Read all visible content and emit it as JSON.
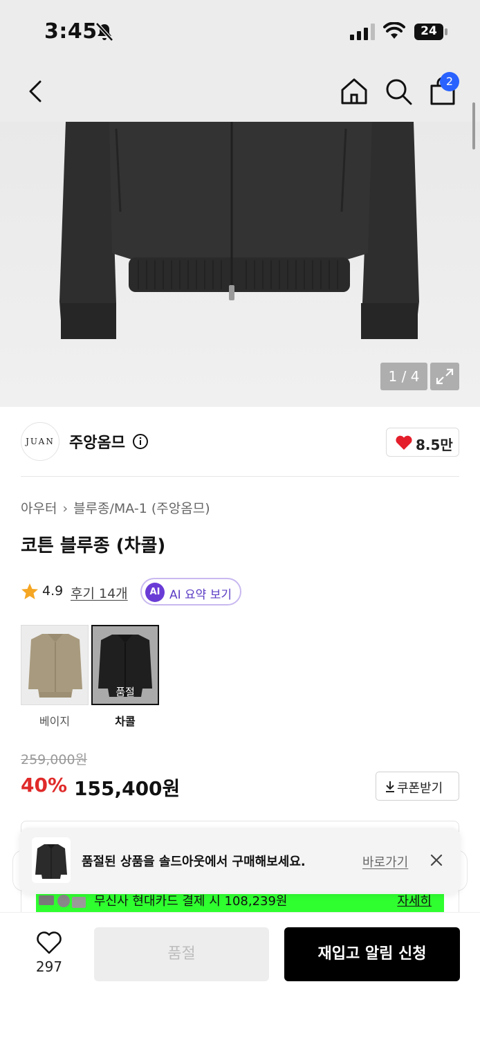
{
  "status_bar": {
    "time": "3:45",
    "battery": "24"
  },
  "header": {
    "cart_count": "2"
  },
  "gallery": {
    "counter": "1 / 4"
  },
  "brand": {
    "logo_text": "JUAN",
    "name": "주앙옴므",
    "like_count": "8.5만"
  },
  "category": {
    "parent": "아우터",
    "child": "블루종/MA-1 (주앙옴므)"
  },
  "product": {
    "title": "코튼 블루종 (차콜)"
  },
  "rating": {
    "score": "4.9",
    "reviews_label": "후기 14개",
    "ai_badge": "AI",
    "ai_label": "AI 요약 보기"
  },
  "colors": {
    "options": [
      {
        "label": "베이지",
        "sold_out": false,
        "selected": false,
        "swatch": "#a89a7e"
      },
      {
        "label": "차콜",
        "sold_out": true,
        "sold_out_label": "품절",
        "selected": true,
        "swatch": "#2b2b2b"
      }
    ]
  },
  "price": {
    "original": "259,000원",
    "discount": "40%",
    "sale": "155,400원",
    "coupon_label": "쿠폰받기"
  },
  "promo_banner": {
    "text": "무신사 현대카드 결제 시 108,239원",
    "link": "자세히"
  },
  "toast": {
    "message": "품절된 상품을 솔드아웃에서 구매해보세요.",
    "link_label": "바로가기"
  },
  "bottom_bar": {
    "wish_count": "297",
    "soldout_label": "품절",
    "restock_label": "재입고 알림 신청"
  },
  "colors_theme": {
    "accent_blue": "#2962ff",
    "discount_red": "#e02a2a",
    "ai_purple": "#6a3cd6",
    "promo_green": "#2fff2f"
  }
}
